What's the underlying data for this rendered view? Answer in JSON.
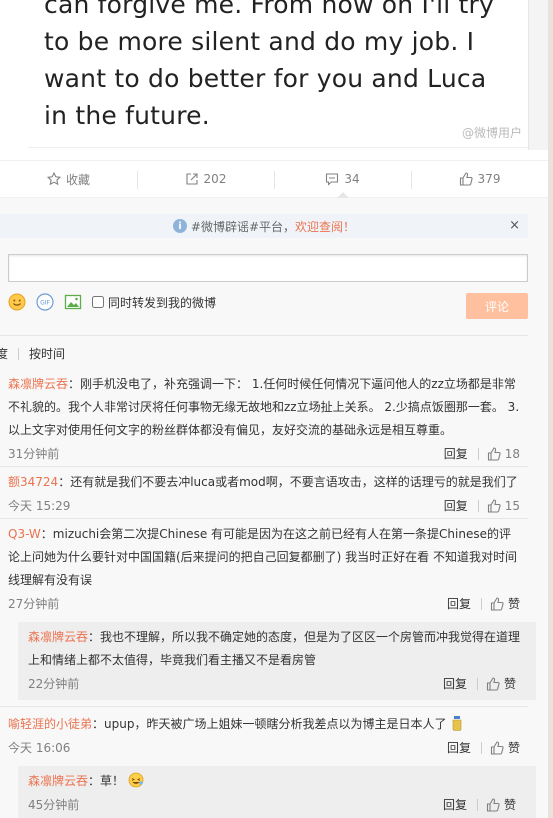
{
  "post": {
    "image_lines": [
      "can forgive me. From now on I'll try",
      "to be more silent and do my job. I",
      "want to do better for you and Luca",
      "in the future."
    ],
    "watermark": "@微博用户"
  },
  "actions": [
    {
      "icon": "star-icon",
      "label": "收藏"
    },
    {
      "icon": "share-icon",
      "label": "202"
    },
    {
      "icon": "comment-icon",
      "label": "34"
    },
    {
      "icon": "thumbs-up-icon",
      "label": "379"
    }
  ],
  "notice": {
    "prefix": "#微博辟谣#平台，",
    "highlight": "欢迎查阅！",
    "close": "×"
  },
  "composer": {
    "input_value": "",
    "forward_label": "同时转发到我的微博",
    "submit_label": "评论"
  },
  "sort": {
    "option1": "度",
    "option2": "按时间"
  },
  "colors": {
    "accent": "#eb7350",
    "submit_bg": "#ffc09f",
    "notice_bg": "#f0f4f9"
  },
  "comments": [
    {
      "user": "森凛牌云吞",
      "text": "：刚手机没电了，补充强调一下： 1.任何时候任何情况下逼问他人的zz立场都是非常不礼貌的。我个人非常讨厌将任何事物无缘无故地和zz立场扯上关系。 2.少搞点饭圈那一套。 3.以上文字对使用任何文字的粉丝群体都没有偏见，友好交流的基础永远是相互尊重。",
      "time": "31分钟前",
      "reply": "回复",
      "likes": "18"
    },
    {
      "user": "额34724",
      "text": "：还有就是我们不要去冲luca或者mod啊，不要言语攻击，这样的话理亏的就是我们了",
      "time": "今天 15:29",
      "reply": "回复",
      "likes": "15"
    },
    {
      "user": "Q3-W",
      "text": "：mizuchi会第二次提Chinese 有可能是因为在这之前已经有人在第一条提Chinese的评论上问她为什么要针对中国国籍(后来提问的把自己回复都删了) 我当时正好在看 不知道我对时间线理解有没有误",
      "time": "27分钟前",
      "reply": "回复",
      "likes": "赞",
      "sub": {
        "user": "森凛牌云吞",
        "text": "：我也不理解，所以我不确定她的态度，但是为了区区一个房管而冲我觉得在道理上和情绪上都不太值得，毕竟我们看主播又不是看房管",
        "time": "22分钟前",
        "reply": "回复",
        "likes": "赞"
      }
    },
    {
      "user": "喻轻涯的小徒弟",
      "text": "：upup，昨天被广场上姐妹一顿瞎分析我差点以为博主是日本人了",
      "time": "今天 16:06",
      "reply": "回复",
      "likes": "赞",
      "sub": {
        "user": "森凛牌云吞",
        "text": "：草！",
        "time": "45分钟前",
        "reply": "回复",
        "likes": "赞"
      }
    }
  ]
}
